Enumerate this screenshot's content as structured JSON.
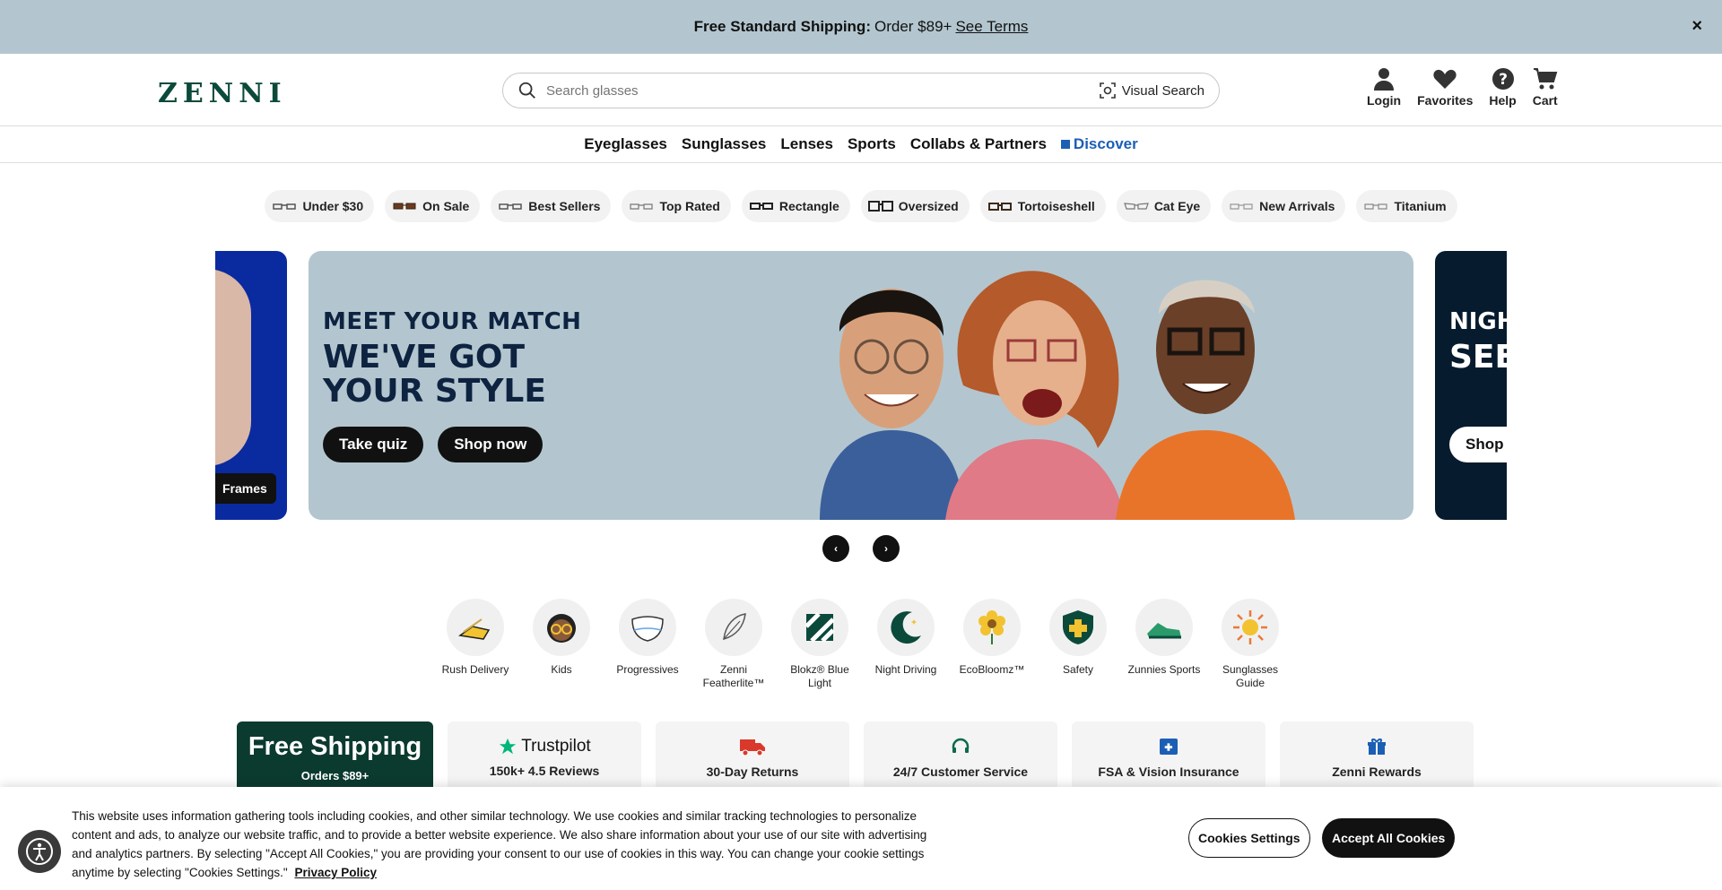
{
  "promo": {
    "bold": "Free Standard Shipping:",
    "text": "Order $89+",
    "link": "See Terms",
    "close": "×"
  },
  "header": {
    "logo": "ZENNI",
    "search_placeholder": "Search glasses",
    "visual_search": "Visual Search",
    "icons": [
      {
        "label": "Login",
        "icon": "user-icon"
      },
      {
        "label": "Favorites",
        "icon": "heart-icon"
      },
      {
        "label": "Help",
        "icon": "help-icon"
      },
      {
        "label": "Cart",
        "icon": "cart-icon"
      }
    ]
  },
  "nav": [
    "Eyeglasses",
    "Sunglasses",
    "Lenses",
    "Sports",
    "Collabs & Partners",
    "Discover"
  ],
  "chips": [
    "Under $30",
    "On Sale",
    "Best Sellers",
    "Top Rated",
    "Rectangle",
    "Oversized",
    "Tortoiseshell",
    "Cat Eye",
    "New Arrivals",
    "Titanium"
  ],
  "carousel": {
    "left_tag": "Frames",
    "main": {
      "kicker": "MEET YOUR MATCH",
      "headline": "WE'VE GOT YOUR STYLE",
      "btn1": "Take quiz",
      "btn2": "Shop now"
    },
    "right": {
      "kicker": "NIGH",
      "headline": "SEE DRIV",
      "btn": "Shop n"
    },
    "prev": "‹",
    "next": "›"
  },
  "categories": [
    "Rush Delivery",
    "Kids",
    "Progressives",
    "Zenni Featherlite™",
    "Blokz® Blue Light",
    "Night Driving",
    "EcoBloomz™",
    "Safety",
    "Zunnies Sports",
    "Sunglasses Guide"
  ],
  "perks": {
    "shipping_big": "Free Shipping",
    "shipping_small": "Orders $89+",
    "trustpilot": "Trustpilot",
    "reviews": "150k+ 4.5 Reviews",
    "returns": "30-Day Returns",
    "service": "24/7 Customer Service",
    "fsa": "FSA & Vision Insurance",
    "rewards": "Zenni Rewards"
  },
  "cookie": {
    "text": "This website uses information gathering tools including cookies, and other similar technology. We use cookies and similar tracking technologies to personalize content and ads, to analyze our website traffic, and to provide a better website experience. We also share information about your use of our site with advertising and analytics partners. By selecting \"Accept All Cookies,\" you are providing your consent to our use of cookies in this way. You can change your cookie settings anytime by selecting \"Cookies Settings.\"",
    "privacy": "Privacy Policy",
    "settings": "Cookies Settings",
    "accept": "Accept All Cookies"
  },
  "colors": {
    "promo_bg": "#b3c6cf",
    "discover": "#1a5fb4",
    "brand_green": "#0b3a2f",
    "dark": "#111111"
  }
}
